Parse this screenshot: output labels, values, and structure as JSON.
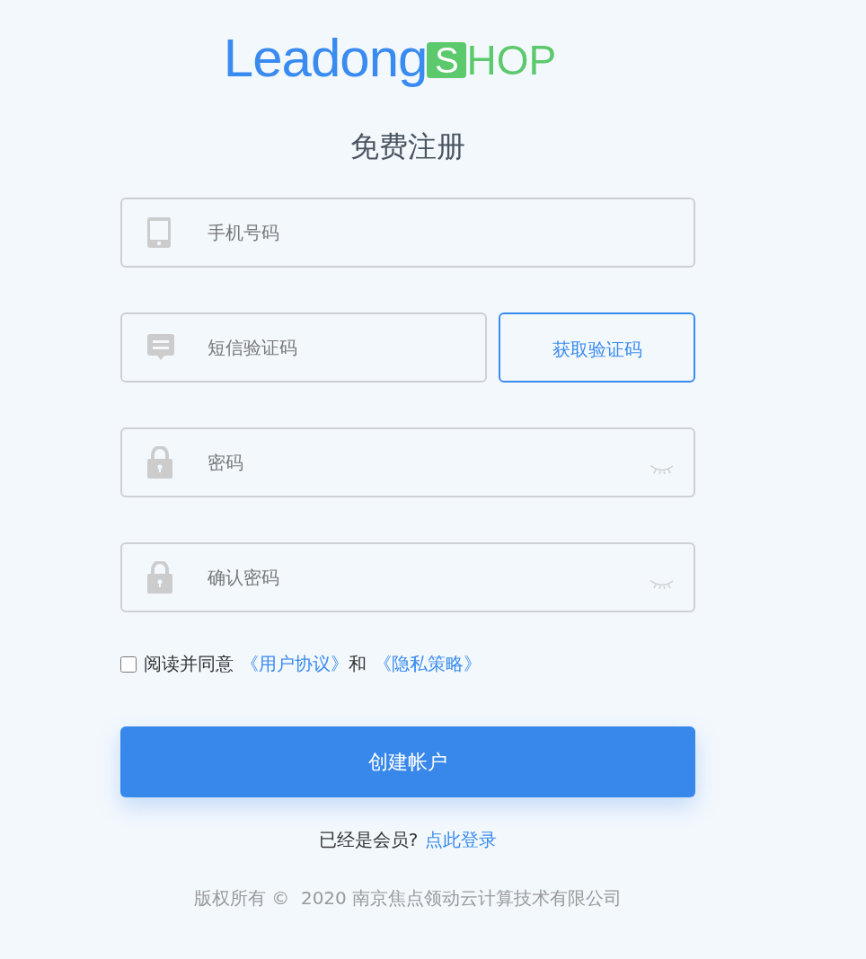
{
  "logo": {
    "main": "Leadong",
    "badge_letter": "S",
    "rest": "HOP"
  },
  "title": "免费注册",
  "fields": [
    {
      "kind": "phone",
      "placeholder": "手机号码"
    },
    {
      "kind": "sms",
      "placeholder": "短信验证码",
      "action": "获取验证码"
    },
    {
      "kind": "password",
      "placeholder": "密码",
      "reveal_toggle": true
    },
    {
      "kind": "password",
      "placeholder": "确认密码",
      "reveal_toggle": true
    }
  ],
  "agreement": {
    "checked": false,
    "text": "阅读并同意",
    "links": [
      "《用户协议》",
      "《隐私策略》"
    ],
    "joiner": "和"
  },
  "submit": "创建帐户",
  "login_prompt": {
    "text": "已经是会员?",
    "link": "点此登录"
  },
  "footer": "版权所有 ©  2020 南京焦点领动云计算技术有限公司"
}
